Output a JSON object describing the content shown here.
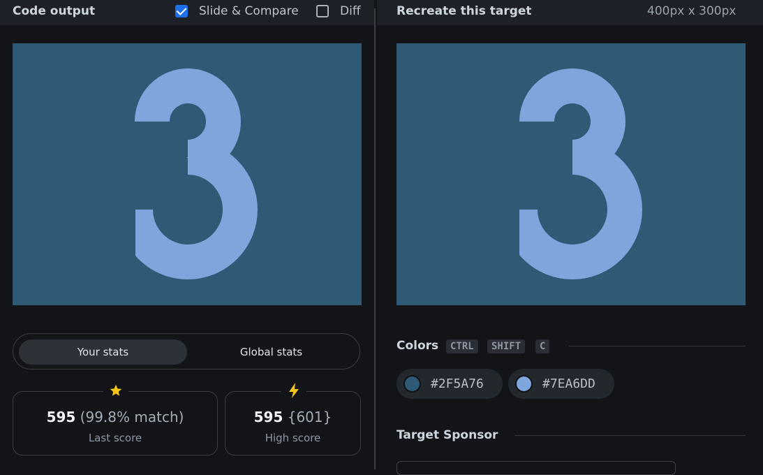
{
  "header": {
    "code_output": "Code output",
    "slide_compare": "Slide & Compare",
    "diff": "Diff",
    "recreate_target": "Recreate this target",
    "dimensions": "400px x 300px"
  },
  "stats": {
    "your_stats": "Your stats",
    "global_stats": "Global stats",
    "last_score": {
      "value": "595",
      "detail": "(99.8% match)",
      "label": "Last score"
    },
    "high_score": {
      "value": "595",
      "detail": "{601}",
      "label": "High score"
    }
  },
  "colors": {
    "title": "Colors",
    "shortcut": [
      "CTRL",
      "SHIFT",
      "C"
    ],
    "swatches": [
      {
        "hex": "#2F5A76",
        "color": "#2f5a76"
      },
      {
        "hex": "#7EA6DD",
        "color": "#7ea6dd"
      }
    ]
  },
  "sponsor": {
    "title": "Target Sponsor"
  },
  "theme": {
    "accent": "#1f6feb",
    "star": "#f5c518"
  }
}
